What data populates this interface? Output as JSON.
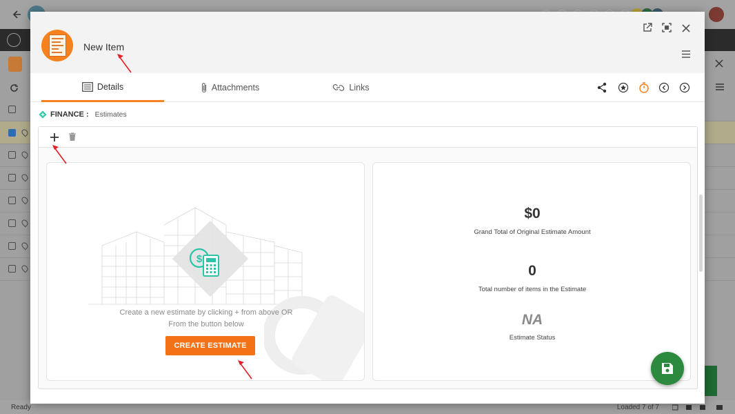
{
  "colors": {
    "accent": "#f5821f",
    "button": "#f47216",
    "teal": "#2bc4a8",
    "save": "#2b8a3e",
    "annotation": "#e31e24"
  },
  "modal": {
    "title": "New Item",
    "icons": [
      "open-external-icon",
      "fullscreen-icon",
      "close-icon",
      "menu-icon"
    ]
  },
  "tabs": [
    {
      "label": "Details",
      "icon": "details-icon",
      "active": true
    },
    {
      "label": "Attachments",
      "icon": "paperclip-icon"
    },
    {
      "label": "Links",
      "icon": "link-icon"
    }
  ],
  "tab_tools": [
    "share-icon",
    "star-icon",
    "timer-icon",
    "prev-icon",
    "next-icon"
  ],
  "breadcrumb": {
    "module": "FINANCE :",
    "section": "Estimates"
  },
  "panel": {
    "toolbar": [
      "add-icon",
      "delete-icon"
    ],
    "empty": {
      "line1": "Create a new estimate by clicking + from above OR",
      "line2": "From the button below",
      "button": "CREATE ESTIMATE"
    },
    "stats": [
      {
        "value": "$0",
        "label": "Grand Total of Original Estimate Amount"
      },
      {
        "value": "0",
        "label": "Total number of items in the Estimate"
      },
      {
        "value": "NA",
        "label": "Estimate Status"
      }
    ]
  },
  "status": {
    "left": "Ready",
    "right": "Loaded 7 of 7"
  }
}
